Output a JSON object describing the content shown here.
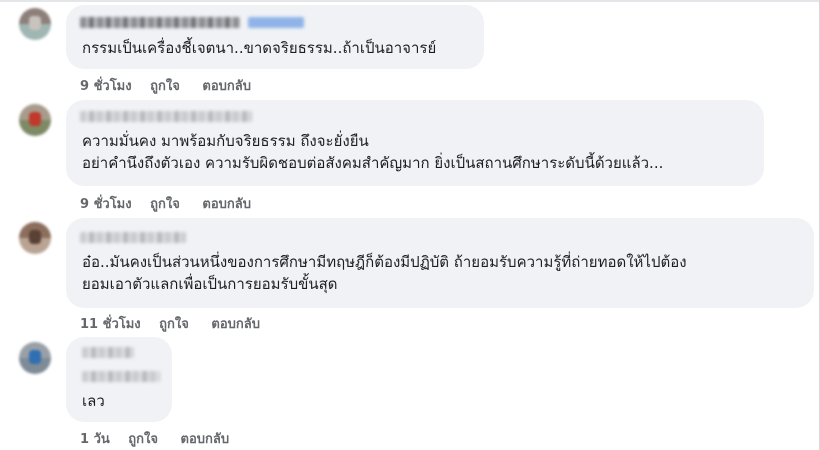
{
  "comments": [
    {
      "text_lines": [
        "กรรมเป็นเครื่องชี้เจตนา..ขาดจริยธรรม..ถ้าเป็นอาจารย์"
      ],
      "time": "9 ชั่วโมง",
      "like_label": "ถูกใจ",
      "reply_label": "ตอบกลับ"
    },
    {
      "text_lines": [
        "ความมั่นคง มาพร้อมกับจริยธรรม ถึงจะยั่งยืน",
        "อย่าคำนึงถึงตัวเอง ความรับผิดชอบต่อสังคมสำคัญมาก ยิ่งเป็นสถานศึกษาระดับนี้ด้วยแล้ว..."
      ],
      "time": "9 ชั่วโมง",
      "like_label": "ถูกใจ",
      "reply_label": "ตอบกลับ"
    },
    {
      "text_lines": [
        "อ๋อ..มันคงเป็นส่วนหนึ่งของการศึกษามีทฤษฎีก็ต้องมีปฏิบัติ ถ้ายอมรับความรู้ที่ถ่ายทอดให้ไปต้อง",
        "ยอมเอาตัวแลกเพื่อเป็นการยอมรับขั้นสุด"
      ],
      "time": "11 ชั่วโมง",
      "like_label": "ถูกใจ",
      "reply_label": "ตอบกลับ"
    },
    {
      "text_lines": [
        "เลว"
      ],
      "time": "1 วัน",
      "like_label": "ถูกใจ",
      "reply_label": "ตอบกลับ"
    }
  ],
  "colors": {
    "bubble_bg": "#f0f2f5",
    "text": "#1c1e21",
    "meta": "#65676b",
    "name_tag": "#8fb3e8"
  }
}
